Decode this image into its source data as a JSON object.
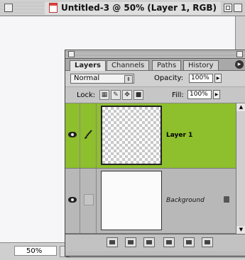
{
  "document": {
    "title": "Untitled-3 @ 50% (Layer 1, RGB)",
    "zoom": "50%"
  },
  "palette": {
    "tabs": [
      {
        "label": "Layers",
        "active": true
      },
      {
        "label": "Channels",
        "active": false
      },
      {
        "label": "Paths",
        "active": false
      },
      {
        "label": "History",
        "active": false
      }
    ],
    "menu_glyph": "▸",
    "blend_mode": "Normal",
    "opacity_label": "Opacity:",
    "opacity_value": "100%",
    "lock_label": "Lock:",
    "fill_label": "Fill:",
    "fill_value": "100%",
    "layers": [
      {
        "name": "Layer 1",
        "selected": true,
        "visible": true,
        "thumbnail": "transparent"
      },
      {
        "name": "Background",
        "selected": false,
        "visible": true,
        "thumbnail": "white",
        "locked": true
      }
    ],
    "footer_icons": [
      "layer-style-icon",
      "mask-icon",
      "new-set-icon",
      "adjustment-layer-icon",
      "new-layer-icon",
      "trash-icon"
    ]
  },
  "colors": {
    "selected_layer": "#8ebf2c"
  }
}
